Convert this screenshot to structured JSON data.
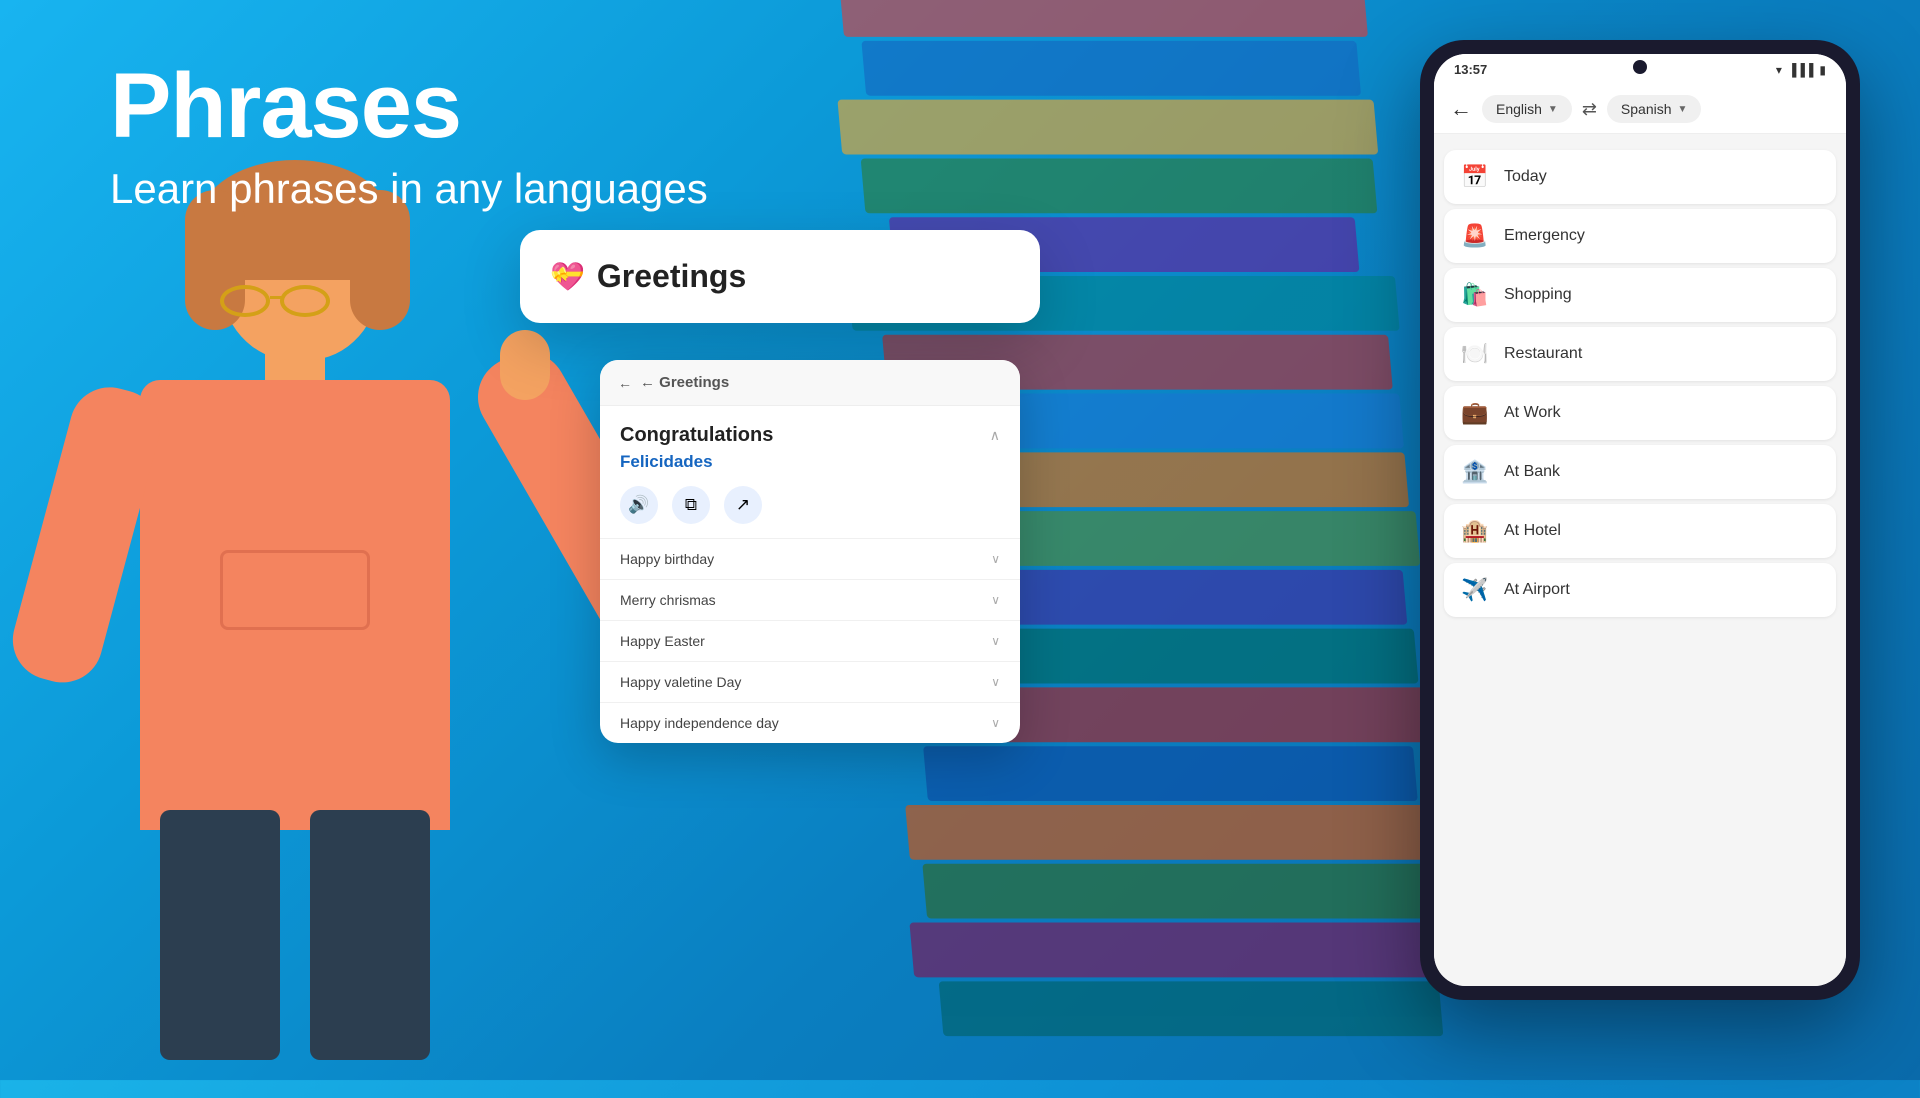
{
  "hero": {
    "title": "Phrases",
    "subtitle": "Learn phrases in any languages"
  },
  "phone": {
    "status_time": "13:57",
    "nav": {
      "back_label": "←",
      "lang_from": "English",
      "lang_to": "Spanish",
      "swap_icon": "⇄"
    },
    "list_items": [
      {
        "id": "today",
        "icon": "📅",
        "label": "Today"
      },
      {
        "id": "emergency",
        "icon": "🚨",
        "label": "Emergency"
      },
      {
        "id": "shopping",
        "icon": "🛍️",
        "label": "Shopping"
      },
      {
        "id": "restaurant",
        "icon": "🍽️",
        "label": "Restaurant"
      },
      {
        "id": "at-work",
        "icon": "💼",
        "label": "At Work"
      },
      {
        "id": "at-bank",
        "icon": "🏦",
        "label": "At Bank"
      },
      {
        "id": "at-hotel",
        "icon": "🏨",
        "label": "At Hotel"
      },
      {
        "id": "at-airport",
        "icon": "✈️",
        "label": "At Airport"
      }
    ]
  },
  "greetings_card": {
    "back_label": "← Greetings",
    "phrase_english": "Congratulations",
    "phrase_spanish": "Felicidades",
    "actions": {
      "sound": "🔊",
      "copy": "📋",
      "share": "↗"
    },
    "sub_phrases": [
      {
        "label": "Happy birthday",
        "id": "happy-birthday"
      },
      {
        "label": "Merry chrismas",
        "id": "merry-christmas"
      },
      {
        "label": "Happy Easter",
        "id": "happy-easter"
      },
      {
        "label": "Happy valetine Day",
        "id": "happy-valentine"
      },
      {
        "label": "Happy independence day",
        "id": "happy-independence"
      }
    ]
  },
  "greetings_panel": {
    "icon": "💝",
    "title": "Greetings"
  },
  "colors": {
    "background_start": "#1ab3e8",
    "background_end": "#0a6aaa",
    "accent_blue": "#1565c0",
    "white": "#ffffff"
  }
}
